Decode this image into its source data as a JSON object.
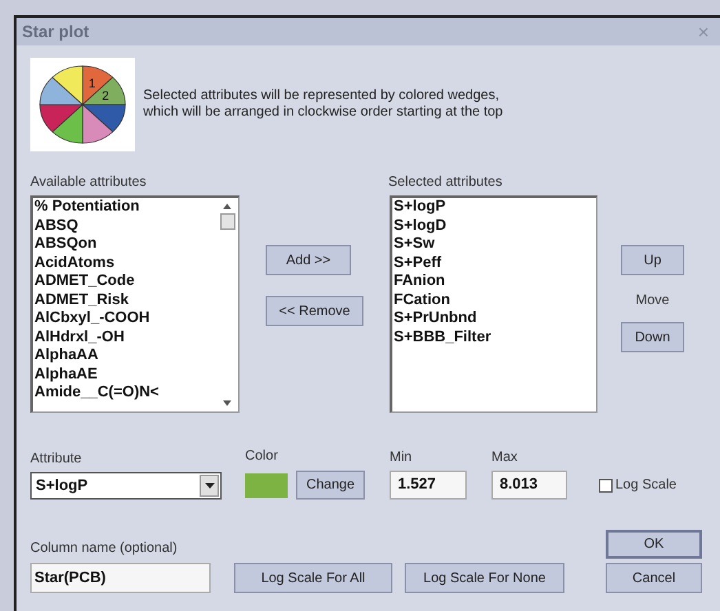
{
  "window": {
    "title": "Star plot",
    "close": "×"
  },
  "legend_icon": {
    "wedge_labels": [
      "1",
      "2"
    ]
  },
  "description": "Selected attributes will be represented by colored wedges,\nwhich will be arranged in clockwise order starting at the top",
  "available": {
    "label": "Available attributes",
    "items": [
      "% Potentiation",
      "ABSQ",
      "ABSQon",
      "AcidAtoms",
      "ADMET_Code",
      "ADMET_Risk",
      "AlCbxyl_-COOH",
      "AlHdrxl_-OH",
      "AlphaAA",
      "AlphaAE",
      "Amide__C(=O)N<"
    ]
  },
  "add_button": "Add >>",
  "remove_button": "<< Remove",
  "selected": {
    "label": "Selected attributes",
    "items": [
      "S+logP",
      "S+logD",
      "S+Sw",
      "S+Peff",
      "FAnion",
      "FCation",
      "S+PrUnbnd",
      "S+BBB_Filter"
    ]
  },
  "up_button": "Up",
  "move_label": "Move",
  "down_button": "Down",
  "attribute": {
    "label": "Attribute",
    "value": "S+logP"
  },
  "color": {
    "label": "Color",
    "color": "#7cb342",
    "button": "Change"
  },
  "min": {
    "label": "Min",
    "value": "1.527"
  },
  "max": {
    "label": "Max",
    "value": "8.013"
  },
  "log_scale": {
    "label": "Log Scale",
    "checked": false
  },
  "column_name": {
    "label": "Column name (optional)",
    "value": "Star(PCB)"
  },
  "log_all_button": "Log Scale For All",
  "log_none_button": "Log Scale For None",
  "ok_button": "OK",
  "cancel_button": "Cancel"
}
